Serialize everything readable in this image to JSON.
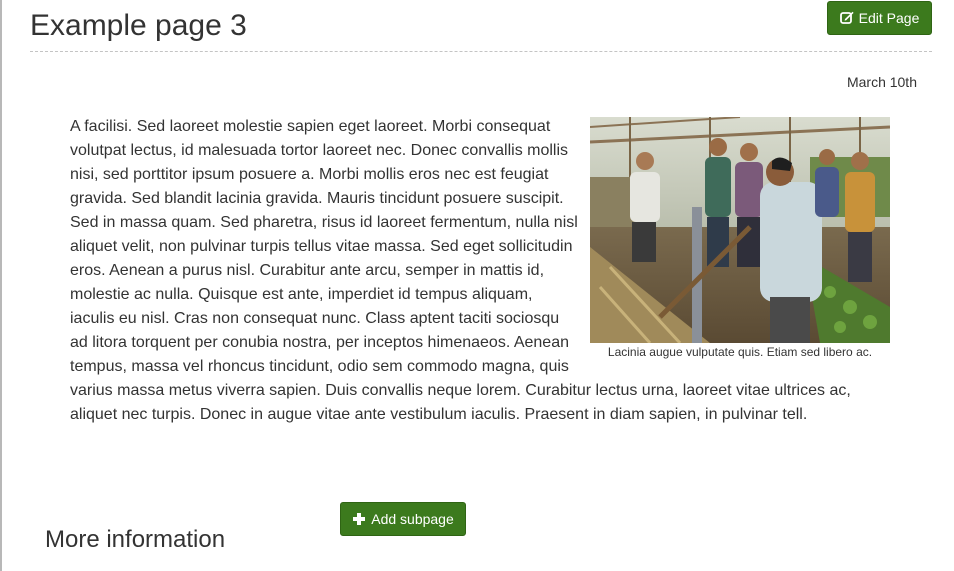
{
  "page": {
    "title": "Example page 3",
    "edit_button_label": "Edit Page",
    "date": "March 10th"
  },
  "article": {
    "body": "A facilisi. Sed laoreet molestie sapien eget laoreet. Morbi consequat volutpat lectus, id malesuada tortor laoreet nec. Donec convallis mollis nisi, sed porttitor ipsum posuere a. Morbi mollis eros nec est feugiat gravida. Sed blandit lacinia gravida. Mauris tincidunt posuere suscipit. Sed in massa quam. Sed pharetra, risus id laoreet fermentum, nulla nisl aliquet velit, non pulvinar turpis tellus vitae massa. Sed eget sollicitudin eros. Aenean a purus nisl. Curabitur ante arcu, semper in mattis id, molestie ac nulla. Quisque est ante, imperdiet id tempus aliquam, iaculis eu nisl. Cras non consequat nunc. Class aptent taciti sociosqu ad litora torquent per conubia nostra, per inceptos himenaeos. Aenean tempus, massa vel rhoncus tincidunt, odio sem commodo magna, quis varius massa metus viverra sapien. Duis convallis neque lorem. Curabitur lectus urna, laoreet vitae ultrices ac, aliquet nec turpis. Donec in augue vitae ante vestibulum iaculis. Praesent in diam sapien, in pulvinar tell.",
    "image_caption": "Lacinia augue vulputate quis. Etiam sed libero ac."
  },
  "subpage": {
    "add_button_label": "Add subpage"
  },
  "more_info": {
    "heading": "More information"
  },
  "icons": {
    "edit": "edit-icon",
    "add": "plus-icon"
  },
  "colors": {
    "button_bg": "#3c7a1d",
    "text": "#333333"
  }
}
